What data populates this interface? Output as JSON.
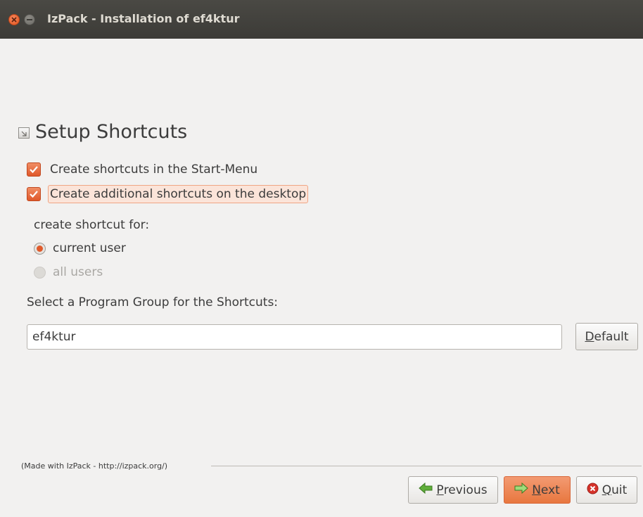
{
  "window": {
    "title": "IzPack - Installation of ef4ktur"
  },
  "panel": {
    "title": "Setup Shortcuts",
    "title_icon": "panel-icon"
  },
  "options": {
    "start_menu_label": "Create shortcuts in the Start-Menu",
    "start_menu_checked": true,
    "desktop_label": "Create additional shortcuts on the desktop",
    "desktop_checked": true
  },
  "shortcut_for": {
    "heading": "create shortcut for:",
    "current_user_label": "current user",
    "current_user_selected": true,
    "all_users_label": "all users",
    "all_users_enabled": false
  },
  "program_group": {
    "label": "Select a Program Group for the Shortcuts:",
    "value": "ef4ktur",
    "default_label_prefix": "D",
    "default_label_rest": "efault"
  },
  "footer": {
    "credit": "(Made with IzPack - http://izpack.org/)",
    "prev_prefix": "P",
    "prev_rest": "revious",
    "next_prefix": "N",
    "next_rest": "ext",
    "quit_prefix": "Q",
    "quit_rest": "uit"
  },
  "colors": {
    "accent": "#e05a2b",
    "titlebar": "#3c3b37",
    "background": "#f2f1f0"
  },
  "icons": {
    "close": "close-icon",
    "minimize": "minimize-icon",
    "previous": "arrow-left-icon",
    "next": "arrow-right-icon",
    "quit": "cancel-icon"
  }
}
